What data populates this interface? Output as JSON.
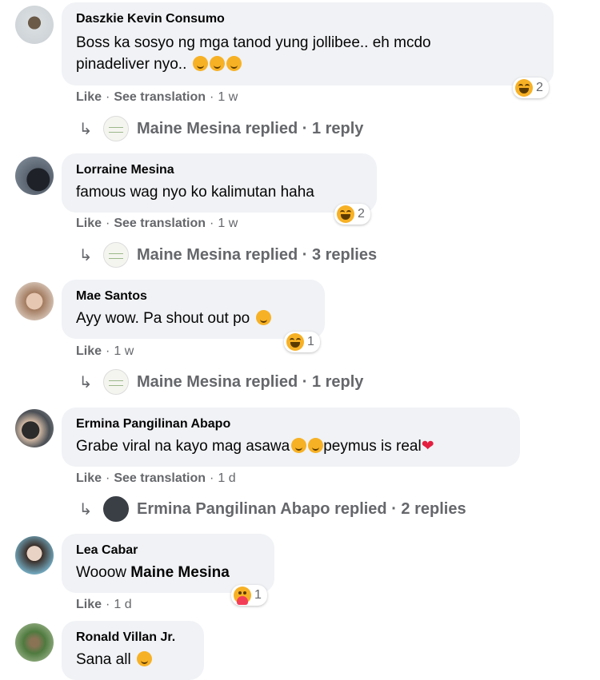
{
  "comments": [
    {
      "author": "Daszkie Kevin Consumo",
      "text_line1": "Boss ka sosyo ng mga tanod yung jollibee.. eh mcdo",
      "text_line2": "pinadeliver nyo..",
      "reaction_count": "2",
      "like": "Like",
      "translate": "See translation",
      "time": "1 w",
      "reply_text": "Maine Mesina replied · 1 reply",
      "reaction_icon": "haha-icon"
    },
    {
      "author": "Lorraine Mesina",
      "text": "famous wag nyo ko kalimutan haha",
      "reaction_count": "2",
      "like": "Like",
      "translate": "See translation",
      "time": "1 w",
      "reply_text": "Maine Mesina replied · 3 replies",
      "reaction_icon": "haha-icon"
    },
    {
      "author": "Mae Santos",
      "text": "Ayy wow. Pa shout out po",
      "reaction_count": "1",
      "like": "Like",
      "time": "1 w",
      "reply_text": "Maine Mesina replied · 1 reply",
      "reaction_icon": "haha-icon"
    },
    {
      "author": "Ermina Pangilinan Abapo",
      "text_a": "Grabe viral na kayo mag asawa",
      "text_b": "peymus is real",
      "like": "Like",
      "translate": "See translation",
      "time": "1 d",
      "reply_text": "Ermina Pangilinan Abapo replied · 2 replies"
    },
    {
      "author": "Lea Cabar",
      "text_plain": "Wooow",
      "text_tag": "Maine Mesina",
      "reaction_count": "1",
      "like": "Like",
      "time": "1 d",
      "reaction_icon": "care-icon"
    },
    {
      "author": "Ronald Villan Jr.",
      "text": "Sana all"
    }
  ],
  "dot_sep": "·",
  "reply_arrow": "↳",
  "colors": {
    "bubble": "#f0f2f5",
    "secondary_text": "#65676b",
    "reaction_yellow": "#f7b125"
  }
}
